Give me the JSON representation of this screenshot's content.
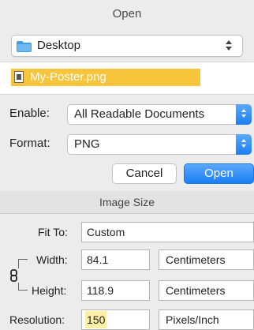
{
  "open_dialog": {
    "title": "Open",
    "location": "Desktop",
    "file": "My-Poster.png",
    "enable_label": "Enable:",
    "enable_value": "All Readable Documents",
    "format_label": "Format:",
    "format_value": "PNG",
    "cancel_label": "Cancel",
    "open_label": "Open"
  },
  "image_size": {
    "title": "Image Size",
    "fit_to_label": "Fit To:",
    "fit_to_value": "Custom",
    "width_label": "Width:",
    "width_value": "84.1",
    "width_unit": "Centimeters",
    "height_label": "Height:",
    "height_value": "118.9",
    "height_unit": "Centimeters",
    "resolution_label": "Resolution:",
    "resolution_value": "150",
    "resolution_unit": "Pixels/Inch"
  },
  "colors": {
    "accent_blue": "#1a7ff4",
    "selection_yellow": "#f7c53c",
    "highlight_yellow": "#fdf0a6",
    "folder_blue": "#3f9de3"
  }
}
